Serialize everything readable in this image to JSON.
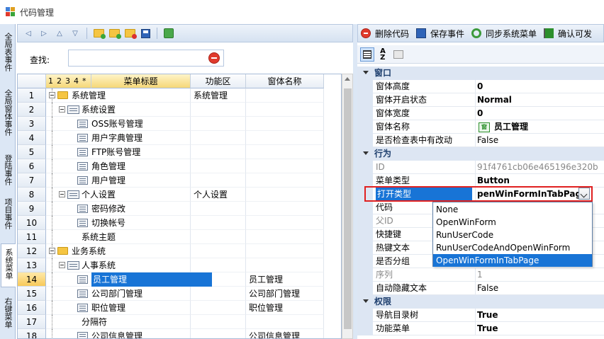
{
  "window": {
    "title": "代码管理"
  },
  "vertical_tabs": [
    "全局表事件",
    "全局窗体事件",
    "登陆事件",
    "项目事件",
    "系统菜单",
    "右键菜单"
  ],
  "active_vertical_tab": "系统菜单",
  "search": {
    "label": "查找:",
    "value": ""
  },
  "grid": {
    "level_headers": [
      "1",
      "2",
      "3",
      "4",
      "*"
    ],
    "columns": {
      "title": "菜单标题",
      "area": "功能区",
      "form": "窗体名称"
    },
    "rows": [
      {
        "num": "1",
        "title": "系统管理",
        "area": "系统管理",
        "form": ""
      },
      {
        "num": "2",
        "title": "系统设置",
        "area": "",
        "form": ""
      },
      {
        "num": "3",
        "title": "OSS账号管理",
        "area": "",
        "form": ""
      },
      {
        "num": "4",
        "title": "用户字典管理",
        "area": "",
        "form": ""
      },
      {
        "num": "5",
        "title": "FTP账号管理",
        "area": "",
        "form": ""
      },
      {
        "num": "6",
        "title": "角色管理",
        "area": "",
        "form": ""
      },
      {
        "num": "7",
        "title": "用户管理",
        "area": "",
        "form": ""
      },
      {
        "num": "8",
        "title": "个人设置",
        "area": "个人设置",
        "form": ""
      },
      {
        "num": "9",
        "title": "密码修改",
        "area": "",
        "form": ""
      },
      {
        "num": "10",
        "title": "切换帐号",
        "area": "",
        "form": ""
      },
      {
        "num": "11",
        "title": "系统主题",
        "area": "",
        "form": ""
      },
      {
        "num": "12",
        "title": "业务系统",
        "area": "",
        "form": ""
      },
      {
        "num": "13",
        "title": "人事系统",
        "area": "",
        "form": ""
      },
      {
        "num": "14",
        "title": "员工管理",
        "area": "",
        "form": "员工管理"
      },
      {
        "num": "15",
        "title": "公司部门管理",
        "area": "",
        "form": "公司部门管理"
      },
      {
        "num": "16",
        "title": "职位管理",
        "area": "",
        "form": "职位管理"
      },
      {
        "num": "17",
        "title": "分隔符",
        "area": "",
        "form": ""
      },
      {
        "num": "18",
        "title": "公司信息管理",
        "area": "",
        "form": "公司信息管理"
      }
    ]
  },
  "right_toolbar": {
    "delete_label": "删除代码",
    "save_label": "保存事件",
    "sync_label": "同步系统菜单",
    "confirm_label": "确认可发"
  },
  "properties": {
    "cat_window": "窗口",
    "cat_behavior": "行为",
    "cat_permission": "权限",
    "window_height": {
      "name": "窗体高度",
      "value": "0"
    },
    "window_state": {
      "name": "窗体开启状态",
      "value": "Normal"
    },
    "window_width": {
      "name": "窗体宽度",
      "value": "0"
    },
    "window_name": {
      "name": "窗体名称",
      "icon_text": "窗",
      "value": "员工管理"
    },
    "check_changes": {
      "name": "是否检查表中有改动",
      "value": "False"
    },
    "id": {
      "name": "ID",
      "value": "91f4761cb06e465196e320b"
    },
    "menu_type": {
      "name": "菜单类型",
      "value": "Button"
    },
    "open_type": {
      "name": "打开类型",
      "value": "penWinFormInTabPage"
    },
    "code": {
      "name": "代码"
    },
    "parent_id": {
      "name": "父ID"
    },
    "shortcut": {
      "name": "快捷键"
    },
    "hotkey_text": {
      "name": "热键文本"
    },
    "is_group": {
      "name": "是否分组"
    },
    "order": {
      "name": "序列",
      "value": "1"
    },
    "auto_hide_text": {
      "name": "自动隐藏文本",
      "value": "False"
    },
    "nav_tree": {
      "name": "导航目录树",
      "value": "True"
    },
    "func_menu": {
      "name": "功能菜单",
      "value": "True"
    }
  },
  "open_type_options": [
    "None",
    "OpenWinForm",
    "RunUserCode",
    "RunUserCodeAndOpenWinForm",
    "OpenWinFormInTabPage"
  ],
  "open_type_selected": "OpenWinFormInTabPage",
  "colors": {
    "selection": "#1874d6",
    "highlight_box": "#e02020",
    "category_bg": "#dde6f3"
  }
}
